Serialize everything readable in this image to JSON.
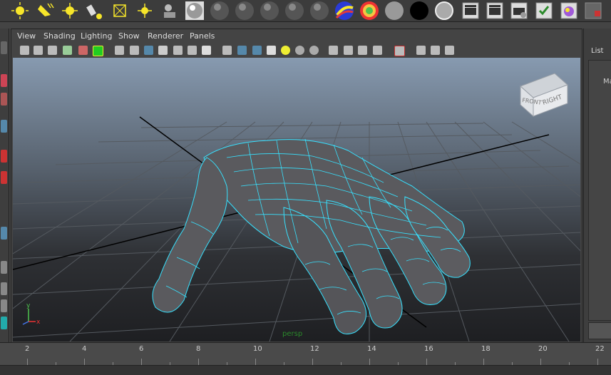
{
  "menu": [
    "View",
    "Shading",
    "Lighting",
    "Show",
    "Renderer",
    "Panels"
  ],
  "viewcube": {
    "front": "FRONT",
    "right": "RIGHT"
  },
  "axis": {
    "y": "y",
    "x": "x"
  },
  "object_label": "persp",
  "right_panel": {
    "tab": "List",
    "inner_label": "Ma"
  },
  "timeline": {
    "ticks": [
      "2",
      "4",
      "6",
      "8",
      "10",
      "12",
      "14",
      "16",
      "18",
      "20",
      "22"
    ]
  },
  "colors": {
    "wireframe": "#37e2ff",
    "mesh": "#5a5a5e",
    "grid": "#555a60",
    "panel_bg": "#444444",
    "shelf_bg": "#3c3c3c"
  },
  "shelf_icons": [
    "point-light-icon",
    "spot-light-icon",
    "area-light-icon",
    "ambient-light-icon",
    "volume-light-icon",
    "directional-light-icon",
    "render-light-icon",
    "material-sphere-icon",
    "blinn-sphere-icon",
    "lambert-sphere-icon",
    "phong-sphere-icon",
    "anisotropic-sphere-icon",
    "surface-shader-icon",
    "ramp-sphere-icon",
    "gray-sphere-icon",
    "black-sphere-icon",
    "gray-swatch-icon",
    "render-clapper-icon",
    "ipr-clapper-icon",
    "batch-render-icon",
    "render-settings-icon",
    "hypershade-icon",
    "render-view-icon"
  ]
}
